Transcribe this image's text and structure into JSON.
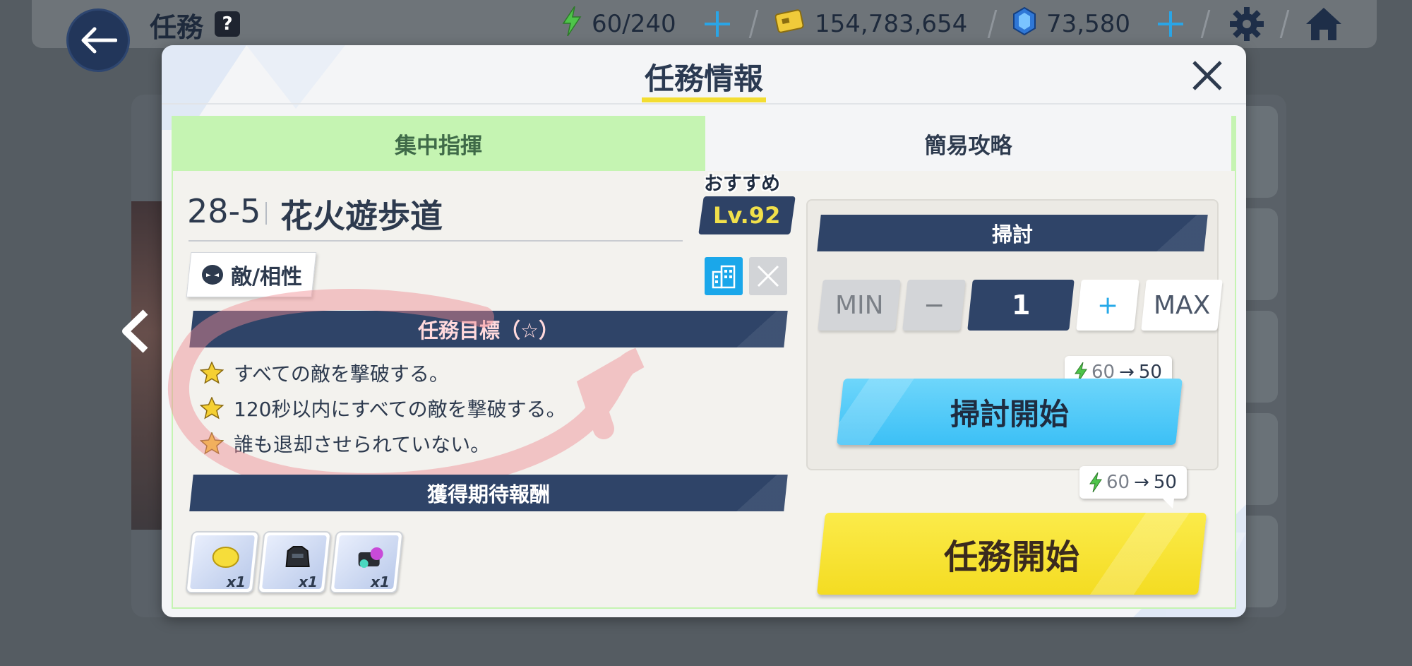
{
  "topbar": {
    "title": "任務",
    "help_badge": "?",
    "ap": "60/240",
    "credits": "154,783,654",
    "gems": "73,580"
  },
  "modal": {
    "title": "任務情報",
    "tabs": [
      {
        "label": "集中指揮"
      },
      {
        "label": "簡易攻略"
      }
    ]
  },
  "stage": {
    "id": "28-5",
    "name": "花火遊歩道",
    "recommend_label": "おすすめ",
    "recommend_level": "Lv.92",
    "enemy_button": "敵/相性"
  },
  "goals": {
    "header": "任務目標（☆）",
    "items": [
      "すべての敵を撃破する。",
      "120秒以内にすべての敵を撃破する。",
      "誰も退却させられていない。"
    ]
  },
  "rewards": {
    "header": "獲得期待報酬",
    "items": [
      {
        "icon": "coin-icon",
        "qty": "x1"
      },
      {
        "icon": "armor-icon",
        "qty": "x1"
      },
      {
        "icon": "gear-item-icon",
        "qty": "x1"
      }
    ]
  },
  "sweep": {
    "header": "掃討",
    "min": "MIN",
    "minus": "−",
    "count": "1",
    "plus": "+",
    "max": "MAX",
    "ap_old": "60",
    "ap_arrow": "→",
    "ap_new": "50",
    "start": "掃討開始"
  },
  "mission": {
    "ap_old": "60",
    "ap_arrow": "→",
    "ap_new": "50",
    "start": "任務開始"
  },
  "colors": {
    "navy": "#2f4468",
    "tab_green": "#c5f4b2",
    "sweep_blue": "#3cc0f6",
    "mission_yellow": "#f4dc22",
    "level_gold": "#f1e04a"
  }
}
